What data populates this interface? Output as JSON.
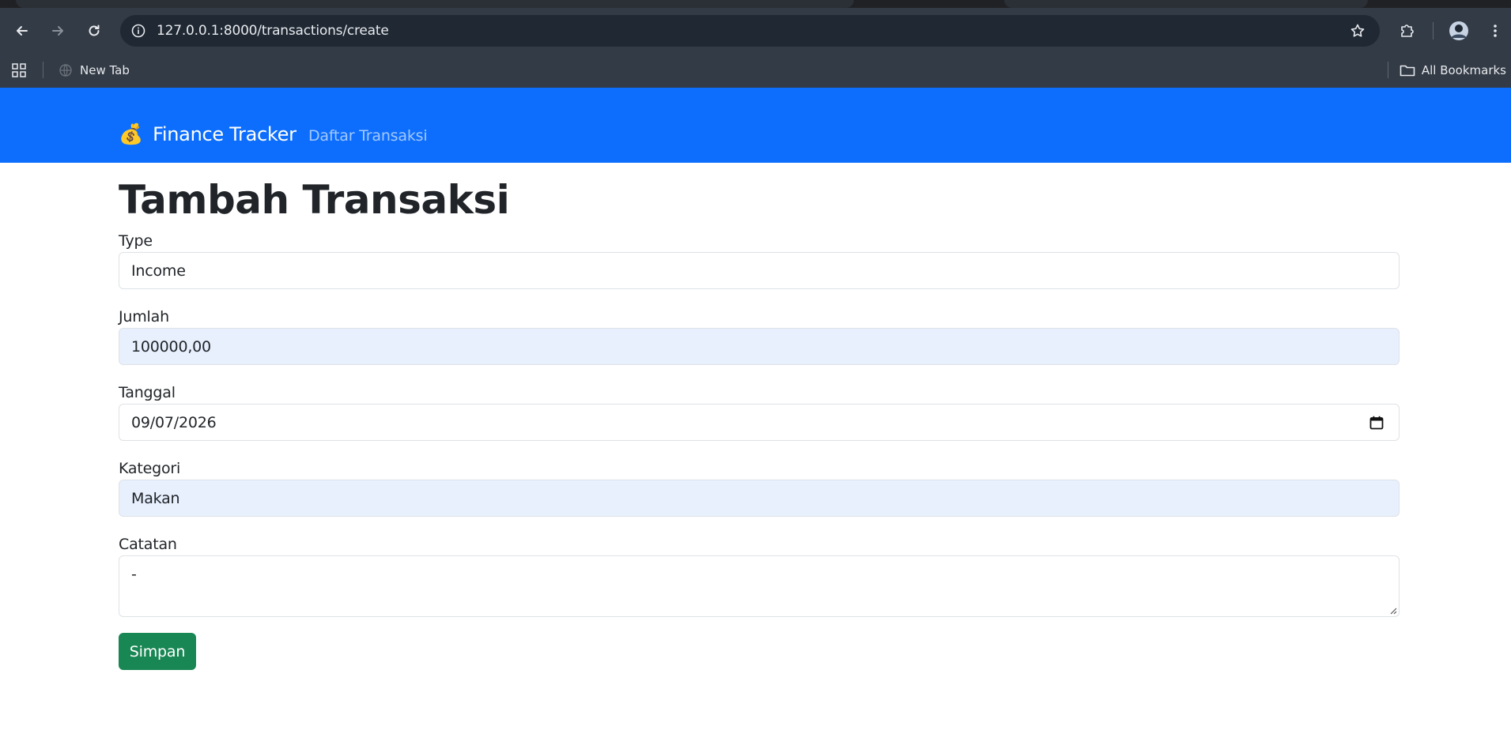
{
  "browser": {
    "url": "127.0.0.1:8000/transactions/create",
    "bookmarks": [
      {
        "label": "New Tab"
      }
    ],
    "all_bookmarks_label": "All Bookmarks"
  },
  "app": {
    "brand_emoji": "💰",
    "brand": "Finance Tracker",
    "nav_link": "Daftar Transaksi"
  },
  "form": {
    "title": "Tambah Transaksi",
    "fields": {
      "type": {
        "label": "Type",
        "value": "Income"
      },
      "amount": {
        "label": "Jumlah",
        "value": "100000,00"
      },
      "date": {
        "label": "Tanggal",
        "value": "09/07/2026"
      },
      "category": {
        "label": "Kategori",
        "value": "Makan"
      },
      "notes": {
        "label": "Catatan",
        "value": "-"
      }
    },
    "submit_label": "Simpan"
  },
  "colors": {
    "navbar": "#0d6efd",
    "submit": "#198754",
    "autofill": "#e8f0fe"
  }
}
